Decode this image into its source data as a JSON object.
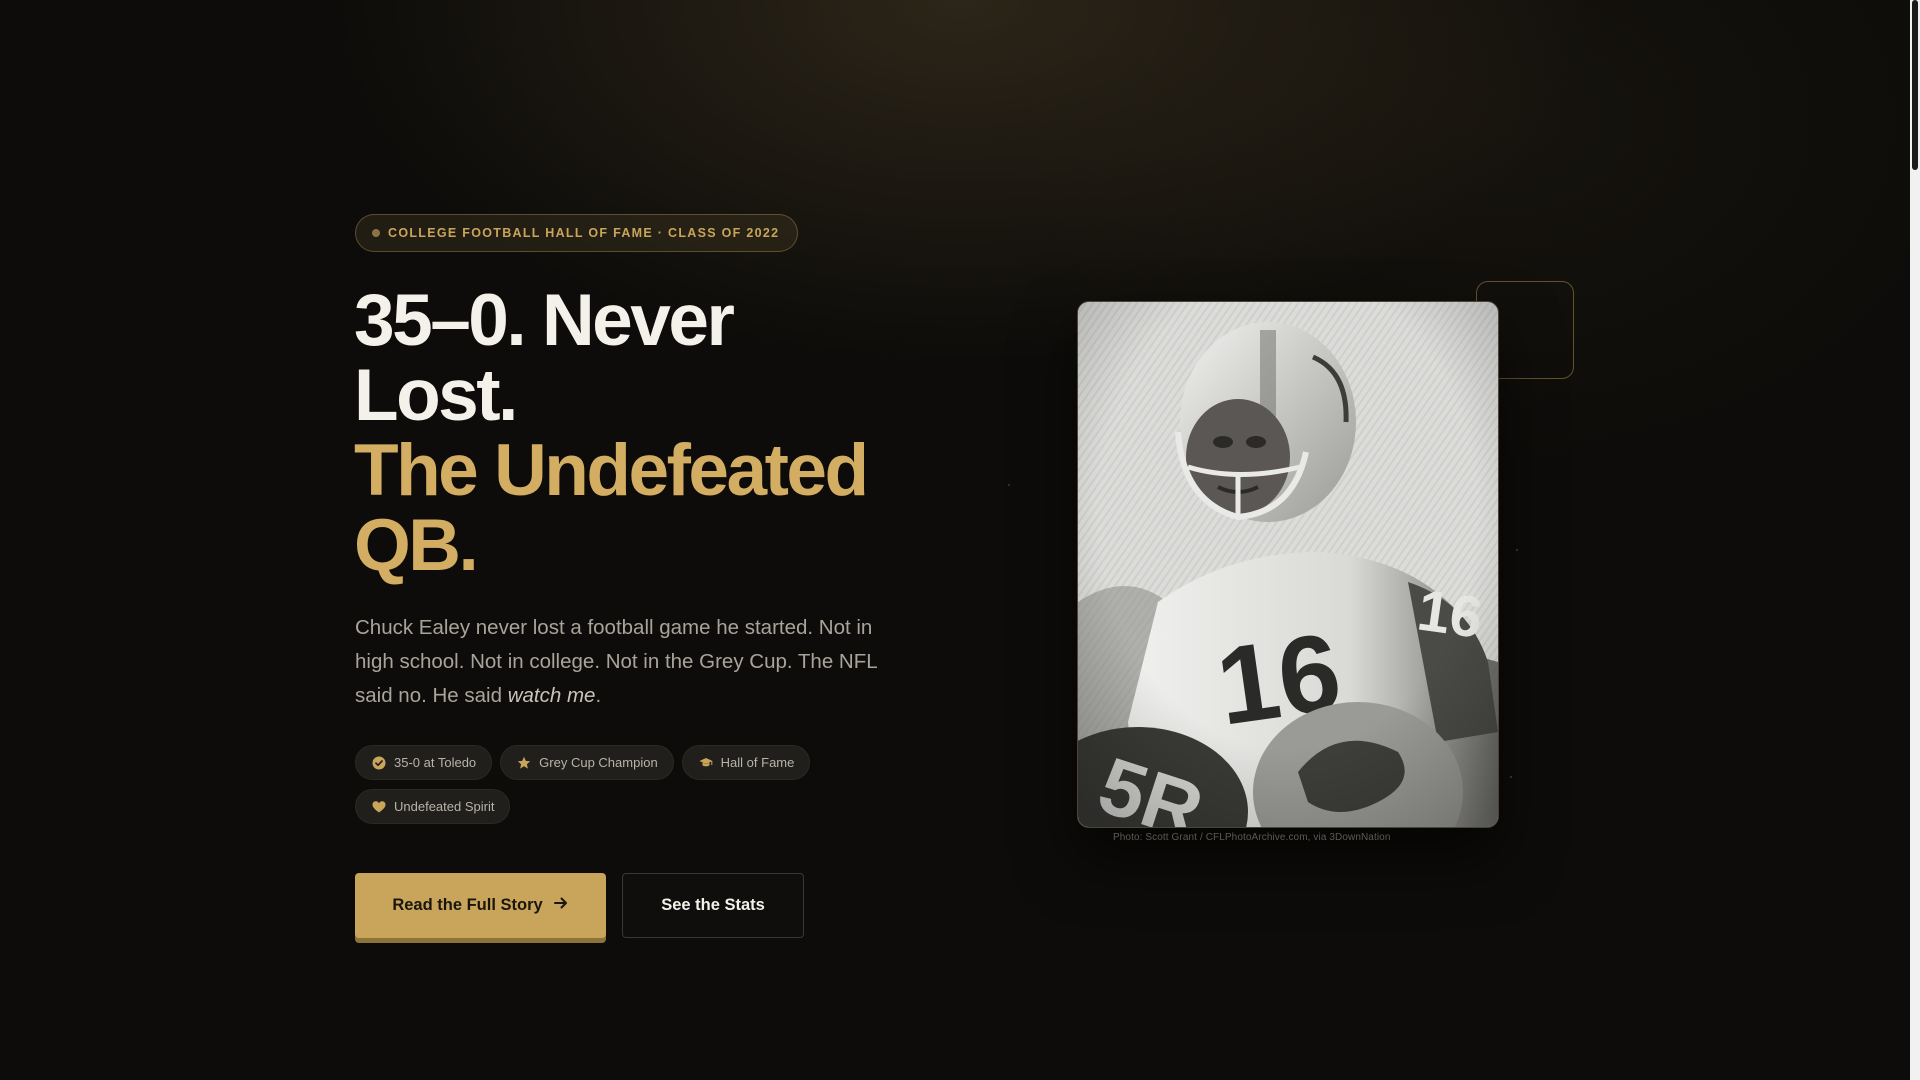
{
  "badge": {
    "text": "COLLEGE FOOTBALL HALL OF FAME · CLASS OF 2022"
  },
  "hero": {
    "headline_line1": "35–0. Never",
    "headline_line2": "Lost.",
    "headline_line3": "The Undefeated",
    "headline_line4": "QB.",
    "lede_main": "Chuck Ealey never lost a football game he started. Not in high school. Not in college. Not in the Grey Cup. The NFL said no. He said ",
    "lede_emphasis": "watch me",
    "lede_end": "."
  },
  "chips": [
    {
      "label": "35-0 at Toledo",
      "icon": "check-circle-icon"
    },
    {
      "label": "Grey Cup Champion",
      "icon": "star-icon"
    },
    {
      "label": "Hall of Fame",
      "icon": "graduation-cap-icon"
    },
    {
      "label": "Undefeated Spirit",
      "icon": "heart-icon"
    }
  ],
  "buttons": {
    "primary_label": "Read the Full Story",
    "secondary_label": "See the Stats"
  },
  "photo": {
    "caption": "Photo: Scott Grant / CFLPhotoArchive.com, via 3DownNation",
    "alt": "Black-and-white photo of a football player in helmet wearing jersey number 16"
  },
  "colors": {
    "accent_gold": "#c9a55c",
    "headline_gold": "#d2ad62",
    "background": "#0d0c0a",
    "text_light": "#f4f1ea"
  }
}
